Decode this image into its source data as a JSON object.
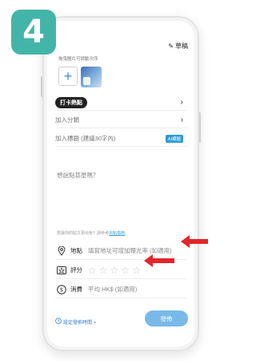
{
  "step_number": "4",
  "header": {
    "draft_label": "草稿"
  },
  "photos": {
    "hint": "拖曳圖片可調動次序",
    "add_symbol": "+"
  },
  "rows": {
    "checkin": "打卡熱點",
    "category": "加入分類",
    "title_placeholder": "加入標題 (建議30字內)",
    "ai_title": "AI標題"
  },
  "body": {
    "placeholder": "想說點甚麼嗎？",
    "hint_prefix": "想讓你的貼文更出色？請參考",
    "hint_link": "出帖指南",
    "hint_suffix": "。"
  },
  "info": {
    "location_label": "地點",
    "location_placeholder": "填寫地址可增加曝光率 (如適用)",
    "rating_label": "評分",
    "spend_label": "消費",
    "spend_placeholder": "平均 HK$ (如適用)"
  },
  "footer": {
    "schedule_label": "設定發佈時間 >",
    "publish_label": "發佈"
  },
  "colors": {
    "badge": "#43b5a8",
    "accent_blue": "#2e9bd6",
    "arrow_red": "#e3252b",
    "publish_bg": "#79b9ea"
  },
  "icons": [
    "pen-icon",
    "plus-icon",
    "chevron-right-icon",
    "location-pin-icon",
    "rating-icon",
    "dollar-icon",
    "clock-icon",
    "star-icon",
    "arrow-icon"
  ]
}
